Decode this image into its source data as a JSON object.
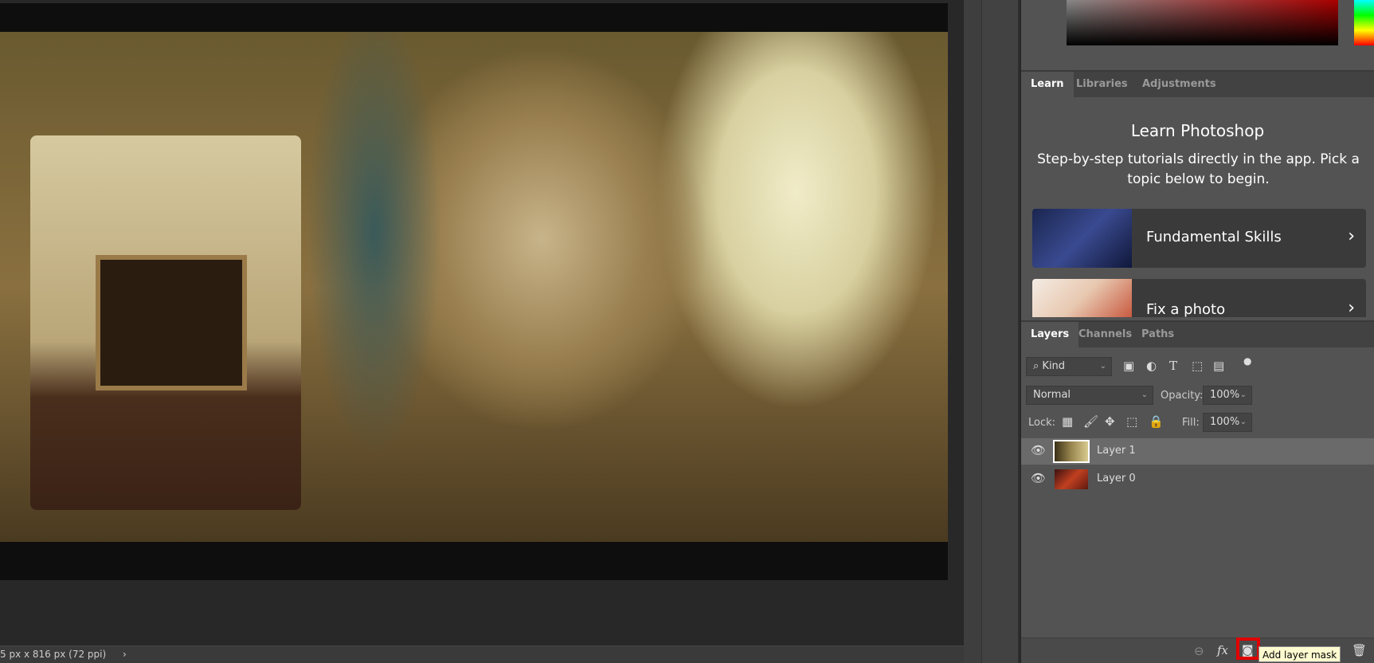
{
  "status_bar": {
    "doc_info": "5 px x 816 px (72 ppi)",
    "chevron": "›"
  },
  "learn_panel": {
    "tabs": [
      {
        "label": "Learn",
        "active": true
      },
      {
        "label": "Libraries",
        "active": false
      },
      {
        "label": "Adjustments",
        "active": false
      }
    ],
    "title": "Learn Photoshop",
    "description": "Step-by-step tutorials directly in the app. Pick a topic below to begin.",
    "cards": [
      {
        "label": "Fundamental Skills",
        "icon": "chevron-right-icon"
      },
      {
        "label": "Fix a photo",
        "icon": "chevron-right-icon"
      }
    ]
  },
  "layers_panel": {
    "tabs": [
      {
        "label": "Layers",
        "active": true
      },
      {
        "label": "Channels",
        "active": false
      },
      {
        "label": "Paths",
        "active": false
      }
    ],
    "filter": {
      "value": "Kind",
      "icons": [
        "image-filter-icon",
        "adjustment-filter-icon",
        "type-filter-icon",
        "shape-filter-icon",
        "smart-object-filter-icon",
        "filter-toggle-icon"
      ]
    },
    "blend_mode": "Normal",
    "opacity_label": "Opacity:",
    "opacity": "100%",
    "lock_label": "Lock:",
    "fill_label": "Fill:",
    "fill": "100%",
    "layers": [
      {
        "name": "Layer 1",
        "visible": true,
        "selected": true
      },
      {
        "name": "Layer 0",
        "visible": true,
        "selected": false
      }
    ],
    "tooltip": "Add layer mask",
    "highlight_color": "#e00000"
  }
}
